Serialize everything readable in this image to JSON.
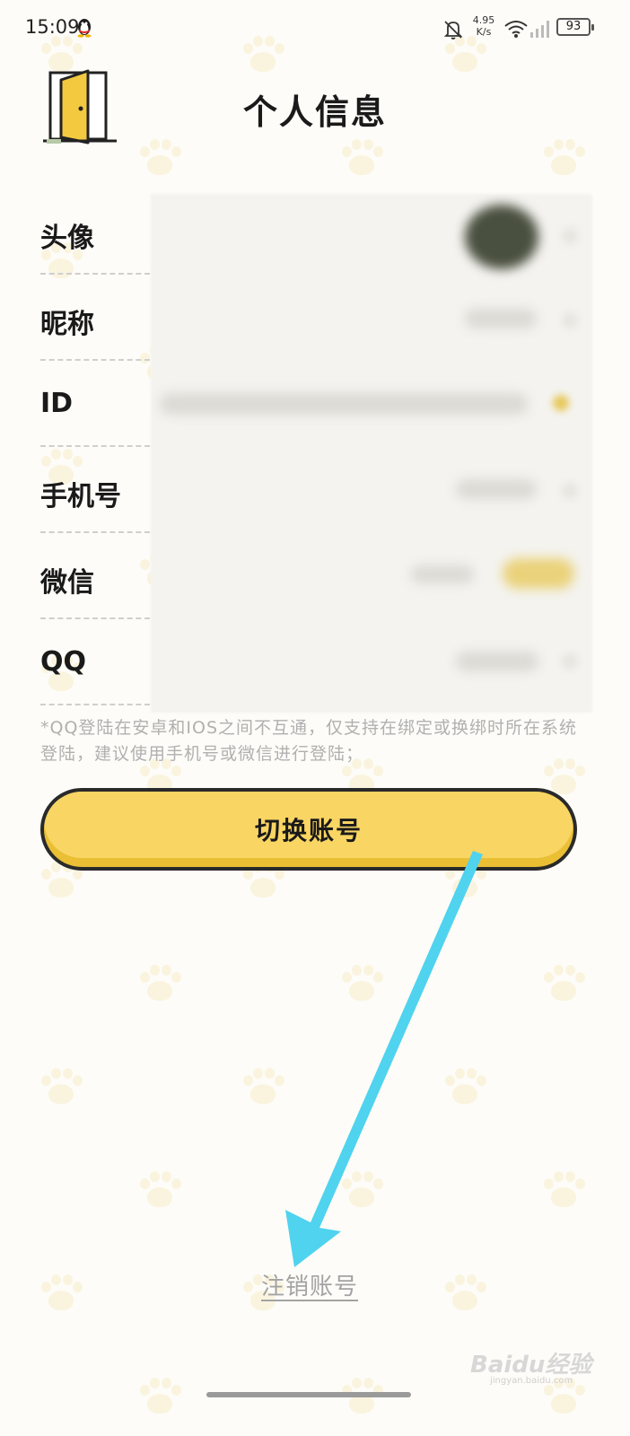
{
  "status_bar": {
    "time": "15:09",
    "net_speed_value": "4.95",
    "net_speed_unit": "K/s",
    "battery": "93"
  },
  "header": {
    "title": "个人信息",
    "back_icon": "exit-door-icon"
  },
  "rows": [
    {
      "label": "头像"
    },
    {
      "label": "昵称"
    },
    {
      "label": "ID"
    },
    {
      "label": "手机号"
    },
    {
      "label": "微信"
    },
    {
      "label": "QQ"
    }
  ],
  "note": "*QQ登陆在安卓和IOS之间不互通，仅支持在绑定或换绑时所在系统登陆，建议使用手机号或微信进行登陆；",
  "switch_account_label": "切换账号",
  "cancel_account_label": "注销账号",
  "watermark": {
    "main": "Baidu经验",
    "sub": "jingyan.baidu.com"
  },
  "colors": {
    "accent_yellow": "#f9d563",
    "arrow_blue": "#4fd3ef",
    "text_dark": "#1a1a1a",
    "note_gray": "#b0b0b0"
  }
}
